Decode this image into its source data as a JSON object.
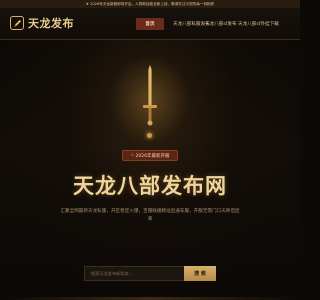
{
  "notice": {
    "text": "★ 2026年天龙新服即将开启，人物新技能全新上线，敬请关注与您的每一刻相伴"
  },
  "header": {
    "logo_text": "天龙发布",
    "nav": [
      {
        "label": "首页",
        "active": true
      },
      {
        "label": "天龙八部私服发布"
      },
      {
        "label": "天龙八部sf发布"
      },
      {
        "label": "天龙八部sf外挂下载"
      }
    ]
  },
  "hero": {
    "badge_icon": "flame-icon",
    "badge_text": "2026年最新开服",
    "title": "天龙八部发布网",
    "description": "汇聚全网最新天龙私服，开区稳定火爆，百服联播精准直通车服，开服无需门口天降但后来",
    "sword_icon": "sword-icon"
  },
  "search": {
    "placeholder": "搜索天龙发布新版本...",
    "value": "",
    "button_label": "搜 索"
  },
  "colors": {
    "accent_gold": "#d9b36a",
    "active_nav": "#6a2a1c",
    "background": "#0c0907"
  }
}
